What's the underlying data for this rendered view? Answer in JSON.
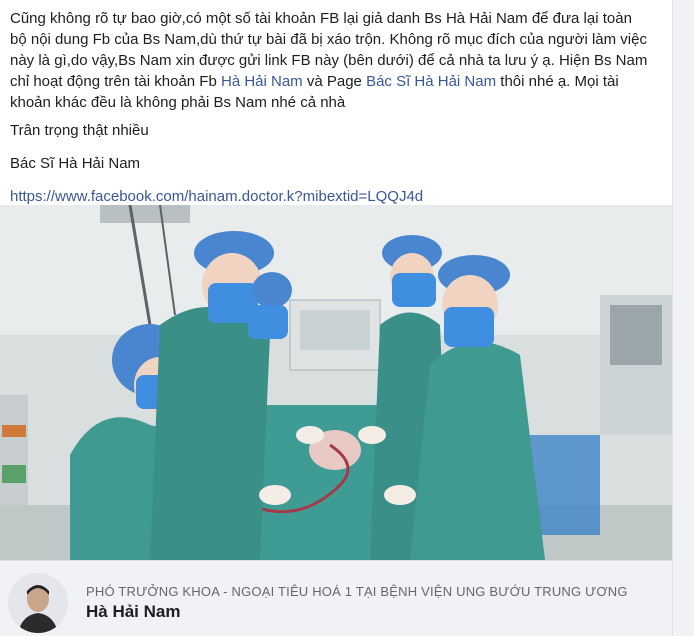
{
  "post": {
    "paragraph_lines": [
      "Cũng không rõ tự bao giờ,có một số tài khoản FB lại giả danh Bs Hà Hải Nam để đưa lại toàn",
      "bộ nội dung Fb của Bs Nam,dù thứ tự bài đã bị xáo trộn. Không rõ mục đích của người làm việc",
      "này là gì,do vậy,Bs Nam xin được gửi link FB này (bên dưới) để cả nhà ta lưu ý ạ. Hiện Bs Nam"
    ],
    "line4_prefix": "chỉ hoạt động trên tài khoản Fb ",
    "line4_link1": "Hà Hải Nam",
    "line4_mid": " và Page ",
    "line4_link2": "Bác Sĩ Hà Hải Nam",
    "line4_suffix": " thôi nhé ạ. Mọi tài",
    "line5": "khoản khác đều là không phải Bs Nam nhé cả nhà",
    "regards": "Trân trọng thật nhiều",
    "signature": "Bác Sĩ Hà Hải Nam",
    "url": "https://www.facebook.com/hainam.doctor.k?mibextid=LQQJ4d"
  },
  "link_preview": {
    "subtitle": "PHÓ TRƯỞNG KHOA - NGOẠI TIÊU HOÁ 1 TẠI BỆNH VIỆN UNG BƯỚU TRUNG ƯƠNG",
    "title": "Hà Hải Nam"
  },
  "colors": {
    "link": "#385898",
    "text": "#1c1e21",
    "scrub": "#3e8f8a",
    "cap": "#4a86cf",
    "mask": "#3f8ee0"
  },
  "icons": {
    "photo": "operating-room-photo",
    "avatar": "profile-avatar"
  }
}
